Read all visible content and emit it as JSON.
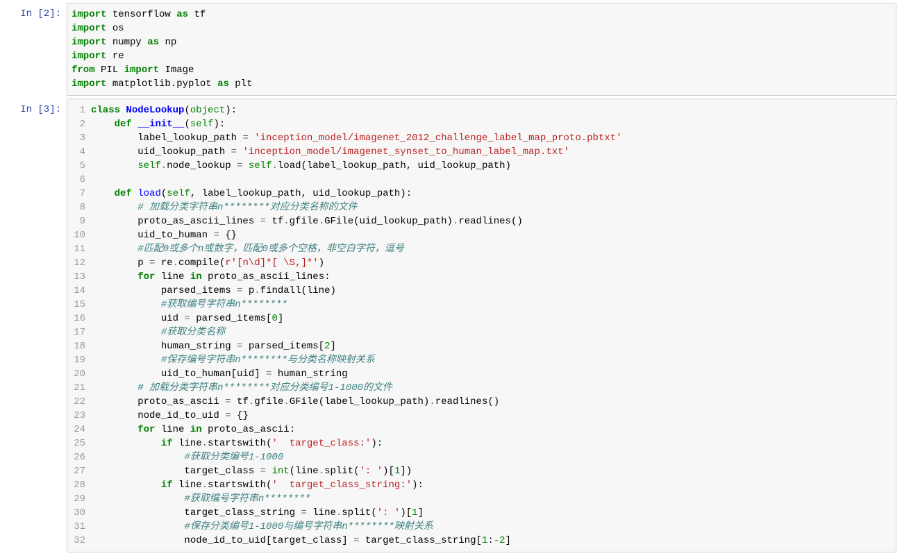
{
  "cells": [
    {
      "prompt": "In  [2]:",
      "showGutter": false,
      "code": [
        [
          [
            "k",
            "import"
          ],
          [
            "p",
            " tensorflow "
          ],
          [
            "k",
            "as"
          ],
          [
            "p",
            " tf"
          ]
        ],
        [
          [
            "k",
            "import"
          ],
          [
            "p",
            " os"
          ]
        ],
        [
          [
            "k",
            "import"
          ],
          [
            "p",
            " numpy "
          ],
          [
            "k",
            "as"
          ],
          [
            "p",
            " np"
          ]
        ],
        [
          [
            "k",
            "import"
          ],
          [
            "p",
            " re"
          ]
        ],
        [
          [
            "k",
            "from"
          ],
          [
            "p",
            " PIL "
          ],
          [
            "k",
            "import"
          ],
          [
            "p",
            " Image"
          ]
        ],
        [
          [
            "k",
            "import"
          ],
          [
            "p",
            " matplotlib.pyplot "
          ],
          [
            "k",
            "as"
          ],
          [
            "p",
            " plt"
          ]
        ]
      ]
    },
    {
      "prompt": "In  [3]:",
      "showGutter": true,
      "gutterStart": 1,
      "code": [
        [
          [
            "k",
            "class"
          ],
          [
            "p",
            " "
          ],
          [
            "nc",
            "NodeLookup"
          ],
          [
            "p",
            "("
          ],
          [
            "nb",
            "object"
          ],
          [
            "p",
            "):"
          ]
        ],
        [
          [
            "p",
            "    "
          ],
          [
            "k",
            "def"
          ],
          [
            "p",
            " "
          ],
          [
            "fm",
            "__init__"
          ],
          [
            "p",
            "("
          ],
          [
            "bp",
            "self"
          ],
          [
            "p",
            "):"
          ]
        ],
        [
          [
            "p",
            "        label_lookup_path "
          ],
          [
            "o",
            "="
          ],
          [
            "p",
            " "
          ],
          [
            "s",
            "'inception_model/imagenet_2012_challenge_label_map_proto.pbtxt'"
          ]
        ],
        [
          [
            "p",
            "        uid_lookup_path "
          ],
          [
            "o",
            "="
          ],
          [
            "p",
            " "
          ],
          [
            "s",
            "'inception_model/imagenet_synset_to_human_label_map.txt'"
          ]
        ],
        [
          [
            "p",
            "        "
          ],
          [
            "bp",
            "self"
          ],
          [
            "o",
            "."
          ],
          [
            "p",
            "node_lookup "
          ],
          [
            "o",
            "="
          ],
          [
            "p",
            " "
          ],
          [
            "bp",
            "self"
          ],
          [
            "o",
            "."
          ],
          [
            "p",
            "load(label_lookup_path, uid_lookup_path)"
          ]
        ],
        [
          [
            "p",
            ""
          ]
        ],
        [
          [
            "p",
            "    "
          ],
          [
            "k",
            "def"
          ],
          [
            "p",
            " "
          ],
          [
            "nf",
            "load"
          ],
          [
            "p",
            "("
          ],
          [
            "bp",
            "self"
          ],
          [
            "p",
            ", label_lookup_path, uid_lookup_path):"
          ]
        ],
        [
          [
            "p",
            "        "
          ],
          [
            "c",
            "# 加载分类字符串n********对应分类名称的文件"
          ]
        ],
        [
          [
            "p",
            "        proto_as_ascii_lines "
          ],
          [
            "o",
            "="
          ],
          [
            "p",
            " tf"
          ],
          [
            "o",
            "."
          ],
          [
            "p",
            "gfile"
          ],
          [
            "o",
            "."
          ],
          [
            "p",
            "GFile(uid_lookup_path)"
          ],
          [
            "o",
            "."
          ],
          [
            "p",
            "readlines()"
          ]
        ],
        [
          [
            "p",
            "        uid_to_human "
          ],
          [
            "o",
            "="
          ],
          [
            "p",
            " {}"
          ]
        ],
        [
          [
            "p",
            "        "
          ],
          [
            "c",
            "#匹配0或多个n或数字，匹配0或多个空格，非空白字符，逗号"
          ]
        ],
        [
          [
            "p",
            "        p "
          ],
          [
            "o",
            "="
          ],
          [
            "p",
            " re"
          ],
          [
            "o",
            "."
          ],
          [
            "p",
            "compile("
          ],
          [
            "sa",
            "r"
          ],
          [
            "s",
            "'[n\\d]*[ \\S,]*'"
          ],
          [
            "p",
            ")"
          ]
        ],
        [
          [
            "p",
            "        "
          ],
          [
            "k",
            "for"
          ],
          [
            "p",
            " line "
          ],
          [
            "k",
            "in"
          ],
          [
            "p",
            " proto_as_ascii_lines:"
          ]
        ],
        [
          [
            "p",
            "            parsed_items "
          ],
          [
            "o",
            "="
          ],
          [
            "p",
            " p"
          ],
          [
            "o",
            "."
          ],
          [
            "p",
            "findall(line)"
          ]
        ],
        [
          [
            "p",
            "            "
          ],
          [
            "c",
            "#获取编号字符串n********"
          ]
        ],
        [
          [
            "p",
            "            uid "
          ],
          [
            "o",
            "="
          ],
          [
            "p",
            " parsed_items["
          ],
          [
            "m",
            "0"
          ],
          [
            "p",
            "]"
          ]
        ],
        [
          [
            "p",
            "            "
          ],
          [
            "c",
            "#获取分类名称"
          ]
        ],
        [
          [
            "p",
            "            human_string "
          ],
          [
            "o",
            "="
          ],
          [
            "p",
            " parsed_items["
          ],
          [
            "m",
            "2"
          ],
          [
            "p",
            "]"
          ]
        ],
        [
          [
            "p",
            "            "
          ],
          [
            "c",
            "#保存编号字符串n********与分类名称映射关系"
          ]
        ],
        [
          [
            "p",
            "            uid_to_human[uid] "
          ],
          [
            "o",
            "="
          ],
          [
            "p",
            " human_string"
          ]
        ],
        [
          [
            "p",
            "        "
          ],
          [
            "c",
            "# 加载分类字符串n********对应分类编号1-1000的文件"
          ]
        ],
        [
          [
            "p",
            "        proto_as_ascii "
          ],
          [
            "o",
            "="
          ],
          [
            "p",
            " tf"
          ],
          [
            "o",
            "."
          ],
          [
            "p",
            "gfile"
          ],
          [
            "o",
            "."
          ],
          [
            "p",
            "GFile(label_lookup_path)"
          ],
          [
            "o",
            "."
          ],
          [
            "p",
            "readlines()"
          ]
        ],
        [
          [
            "p",
            "        node_id_to_uid "
          ],
          [
            "o",
            "="
          ],
          [
            "p",
            " {}"
          ]
        ],
        [
          [
            "p",
            "        "
          ],
          [
            "k",
            "for"
          ],
          [
            "p",
            " line "
          ],
          [
            "k",
            "in"
          ],
          [
            "p",
            " proto_as_ascii:"
          ]
        ],
        [
          [
            "p",
            "            "
          ],
          [
            "k",
            "if"
          ],
          [
            "p",
            " line"
          ],
          [
            "o",
            "."
          ],
          [
            "p",
            "startswith("
          ],
          [
            "s",
            "'  target_class:'"
          ],
          [
            "p",
            "):"
          ]
        ],
        [
          [
            "p",
            "                "
          ],
          [
            "c",
            "#获取分类编号1-1000"
          ]
        ],
        [
          [
            "p",
            "                target_class "
          ],
          [
            "o",
            "="
          ],
          [
            "p",
            " "
          ],
          [
            "nb",
            "int"
          ],
          [
            "p",
            "(line"
          ],
          [
            "o",
            "."
          ],
          [
            "p",
            "split("
          ],
          [
            "s",
            "': '"
          ],
          [
            "p",
            ")["
          ],
          [
            "m",
            "1"
          ],
          [
            "p",
            "])"
          ]
        ],
        [
          [
            "p",
            "            "
          ],
          [
            "k",
            "if"
          ],
          [
            "p",
            " line"
          ],
          [
            "o",
            "."
          ],
          [
            "p",
            "startswith("
          ],
          [
            "s",
            "'  target_class_string:'"
          ],
          [
            "p",
            "):"
          ]
        ],
        [
          [
            "p",
            "                "
          ],
          [
            "c",
            "#获取编号字符串n********"
          ]
        ],
        [
          [
            "p",
            "                target_class_string "
          ],
          [
            "o",
            "="
          ],
          [
            "p",
            " line"
          ],
          [
            "o",
            "."
          ],
          [
            "p",
            "split("
          ],
          [
            "s",
            "': '"
          ],
          [
            "p",
            ")["
          ],
          [
            "m",
            "1"
          ],
          [
            "p",
            "]"
          ]
        ],
        [
          [
            "p",
            "                "
          ],
          [
            "c",
            "#保存分类编号1-1000与编号字符串n********映射关系"
          ]
        ],
        [
          [
            "p",
            "                node_id_to_uid[target_class] "
          ],
          [
            "o",
            "="
          ],
          [
            "p",
            " target_class_string["
          ],
          [
            "m",
            "1"
          ],
          [
            "p",
            ":"
          ],
          [
            "o",
            "-"
          ],
          [
            "m",
            "2"
          ],
          [
            "p",
            "]"
          ]
        ]
      ]
    }
  ]
}
